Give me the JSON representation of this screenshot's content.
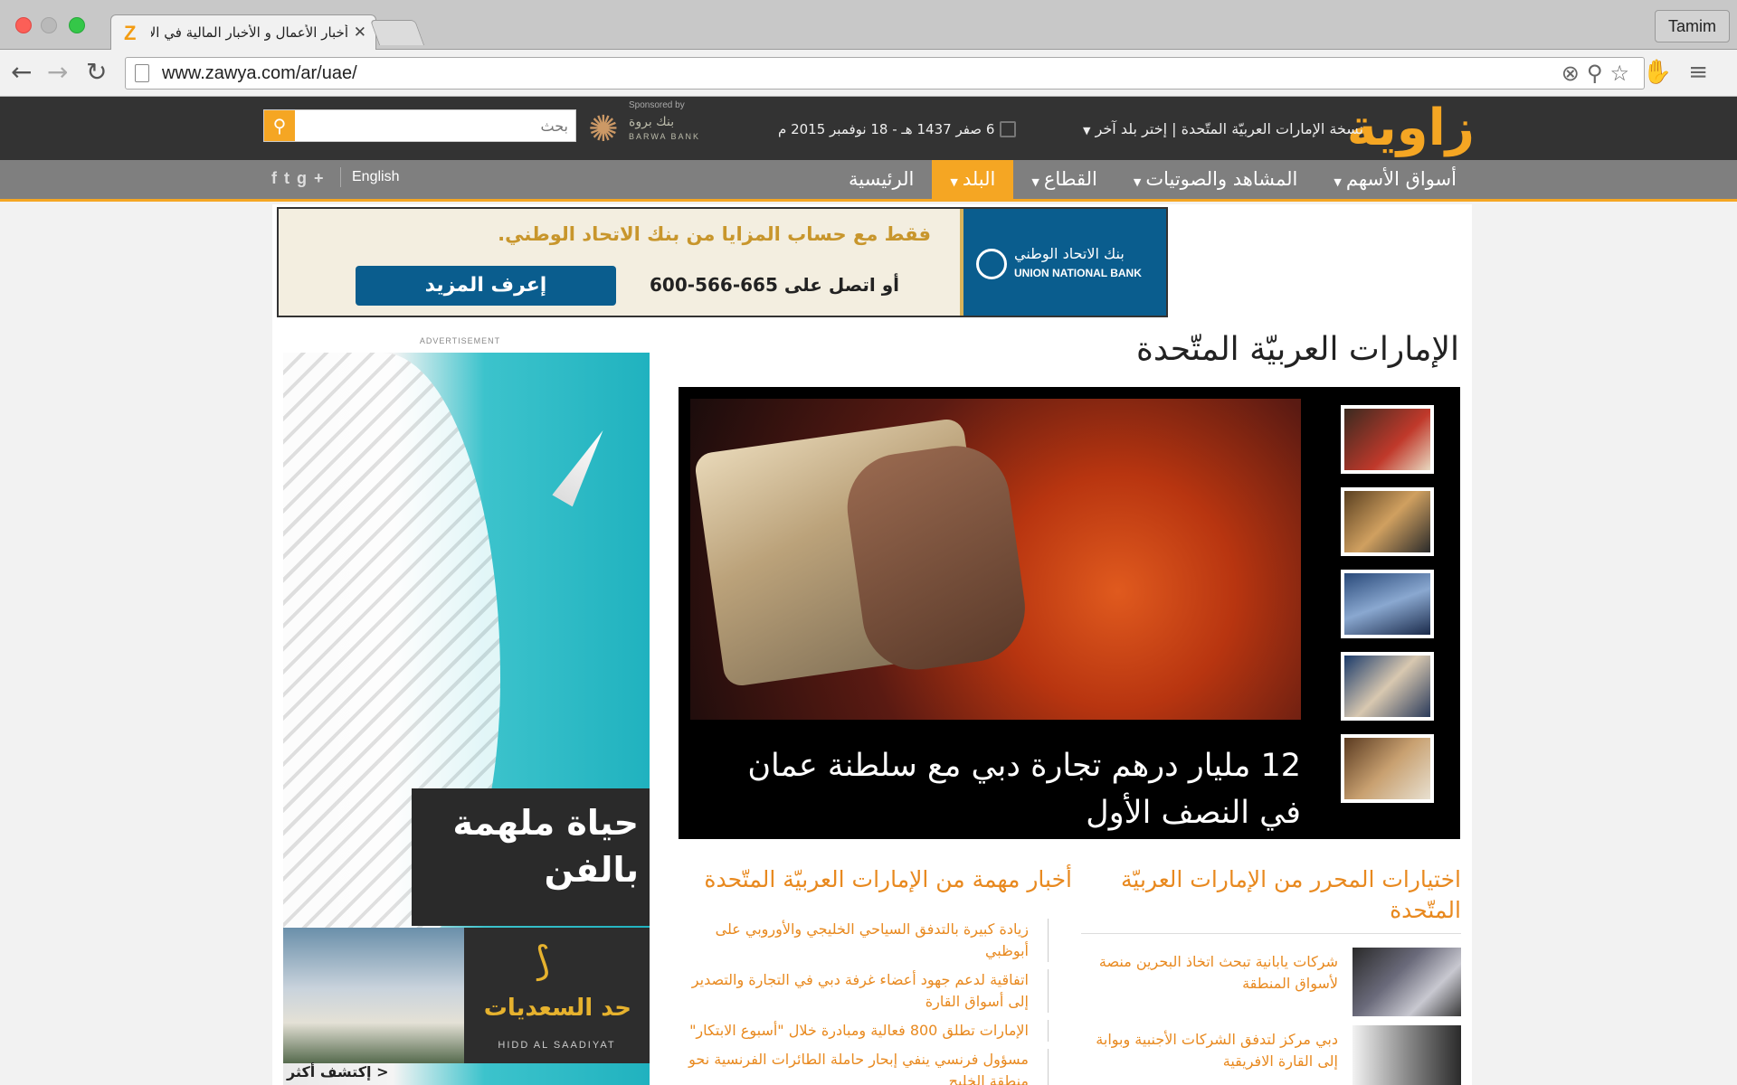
{
  "browser": {
    "tab_title": "أخبار الأعمال و الأخبار المالية في الإمارات",
    "tab_favicon": "Z",
    "profile_name": "Tamim",
    "url": "www.zawya.com/ar/uae/"
  },
  "header": {
    "logo": "زاوية",
    "edition": "نسخة الإمارات العربيّة المتّحدة | إختر بلد آخر",
    "date": "6 صفر 1437 هـ - 18 نوفمبر 2015 م",
    "sponsor_label": "Sponsored by",
    "sponsor_name_ar": "بنك بروة",
    "sponsor_name_en": "BARWA BANK",
    "search_placeholder": "بحث"
  },
  "nav": {
    "items": [
      {
        "label": "الرئيسية",
        "has_menu": false,
        "active": false
      },
      {
        "label": "البلد",
        "has_menu": true,
        "active": true
      },
      {
        "label": "القطاع",
        "has_menu": true,
        "active": false
      },
      {
        "label": "المشاهد والصوتيات",
        "has_menu": true,
        "active": false
      },
      {
        "label": "أسواق الأسهم",
        "has_menu": true,
        "active": false
      }
    ],
    "language": "English",
    "social": [
      "f",
      "t",
      "g+"
    ]
  },
  "banner_ad": {
    "headline": "فقط مع حساب المزايا من بنك الاتحاد الوطني.",
    "cta": "إعرف المزيد",
    "phone": "أو اتصل على 665-566-600",
    "brand_ar": "بنك الاتحاد الوطني",
    "brand_en": "UNION NATIONAL BANK"
  },
  "side_ad": {
    "label": "ADVERTISEMENT",
    "tagline": "حياة ملهمة بالفن",
    "brand_ar": "حد السعديات",
    "brand_en": "HIDD AL SAADIYAT",
    "more": "< إكتشف أكثر"
  },
  "main": {
    "page_title": "الإمارات العربيّة المتّحدة",
    "hero_headline": "12 مليار درهم تجارة دبي مع سلطنة عمان في النصف الأول",
    "editor_section_title": "اختيارات المحرر من الإمارات العربيّة المتّحدة",
    "important_section_title": "أخبار مهمة من الإمارات العربيّة المتّحدة",
    "important_news": [
      "زيادة كبيرة بالتدفق السياحي الخليجي والأوروبي على أبوظبي",
      "اتفاقية لدعم جهود أعضاء غرفة دبي في التجارة والتصدير إلى أسواق القارة",
      "الإمارات تطلق 800 فعالية ومبادرة خلال \"أسبوع الابتكار\"",
      "مسؤول فرنسي ينفي إبحار حاملة الطائرات الفرنسية نحو منطقة الخليج"
    ],
    "editor_picks": [
      "شركات يابانية تبحث اتخاذ البحرين منصة لأسواق المنطقة",
      "دبي مركز لتدفق الشركات الأجنبية وبوابة إلى القارة الافريقية"
    ]
  }
}
